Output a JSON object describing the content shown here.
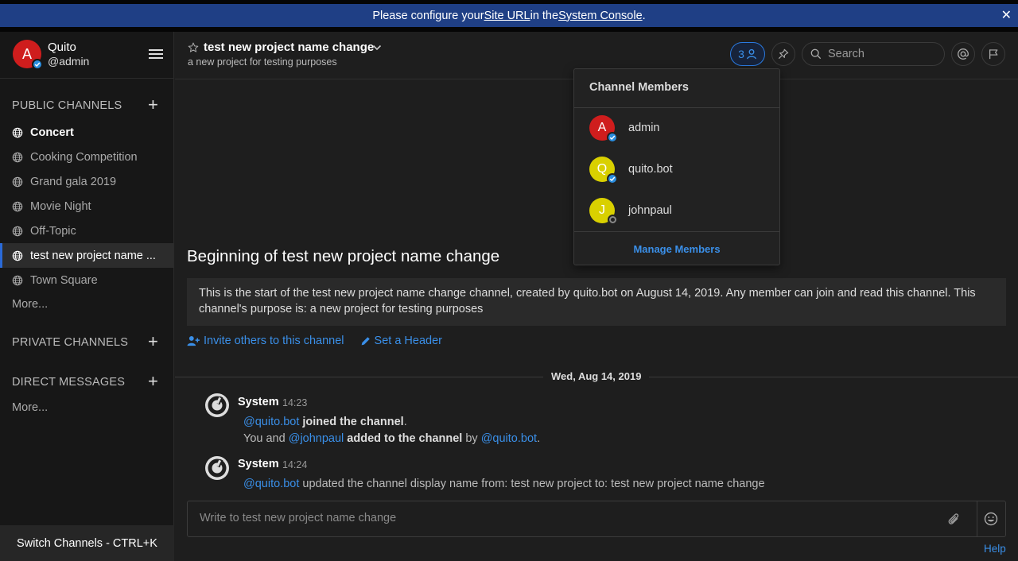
{
  "banner": {
    "text_before": "Please configure your ",
    "link1": "Site URL",
    "text_middle": " in the ",
    "link2": "System Console",
    "text_after": ".",
    "close": "✕"
  },
  "team": {
    "avatar_letter": "A",
    "name": "Quito",
    "username": "@admin"
  },
  "sidebar": {
    "public_title": "PUBLIC CHANNELS",
    "public_channels": [
      {
        "label": "Concert"
      },
      {
        "label": "Cooking Competition"
      },
      {
        "label": "Grand gala 2019"
      },
      {
        "label": "Movie Night"
      },
      {
        "label": "Off-Topic"
      },
      {
        "label": "test new project name ..."
      },
      {
        "label": "Town Square"
      }
    ],
    "public_more": "More...",
    "private_title": "PRIVATE CHANNELS",
    "direct_title": "DIRECT MESSAGES",
    "direct_more": "More...",
    "add_symbol": "+",
    "switch_channels": "Switch Channels - CTRL+K"
  },
  "header": {
    "title": "test new project name change",
    "purpose": "a new project for testing purposes",
    "member_count": "3",
    "search_placeholder": "Search"
  },
  "intro": {
    "title": "Beginning of test new project name change",
    "description": "This is the start of the test new project name change channel, created by quito.bot on August 14, 2019. Any member can join and read this channel. This channel's purpose is: a new project for testing purposes",
    "invite": "Invite others to this channel",
    "set_header": "Set a Header"
  },
  "date_separator": "Wed, Aug 14, 2019",
  "posts": [
    {
      "author": "System",
      "time": "14:23",
      "line1_mention": "@quito.bot",
      "line1_strong": " joined the channel",
      "line1_end": ".",
      "line2_start": "You and ",
      "line2_mention": "@johnpaul",
      "line2_strong": " added to the channel",
      "line2_by": " by ",
      "line2_mention2": "@quito.bot",
      "line2_end": "."
    },
    {
      "author": "System",
      "time": "14:24",
      "line1_mention": "@quito.bot",
      "line1_text": " updated the channel display name from: test new project to: test new project name change"
    }
  ],
  "composer": {
    "placeholder": "Write to test new project name change"
  },
  "help": "Help",
  "members_popover": {
    "title": "Channel Members",
    "members": [
      {
        "letter": "A",
        "name": "admin",
        "color": "#cf1d1d",
        "status": "verified"
      },
      {
        "letter": "Q",
        "name": "quito.bot",
        "color": "#d9d000",
        "status": "verified"
      },
      {
        "letter": "J",
        "name": "johnpaul",
        "color": "#d9d000",
        "status": "offline"
      }
    ],
    "manage": "Manage Members"
  },
  "colors": {
    "accent": "#3a8fe8",
    "banner": "#1f3f85",
    "sidebar_bg": "#171717"
  }
}
